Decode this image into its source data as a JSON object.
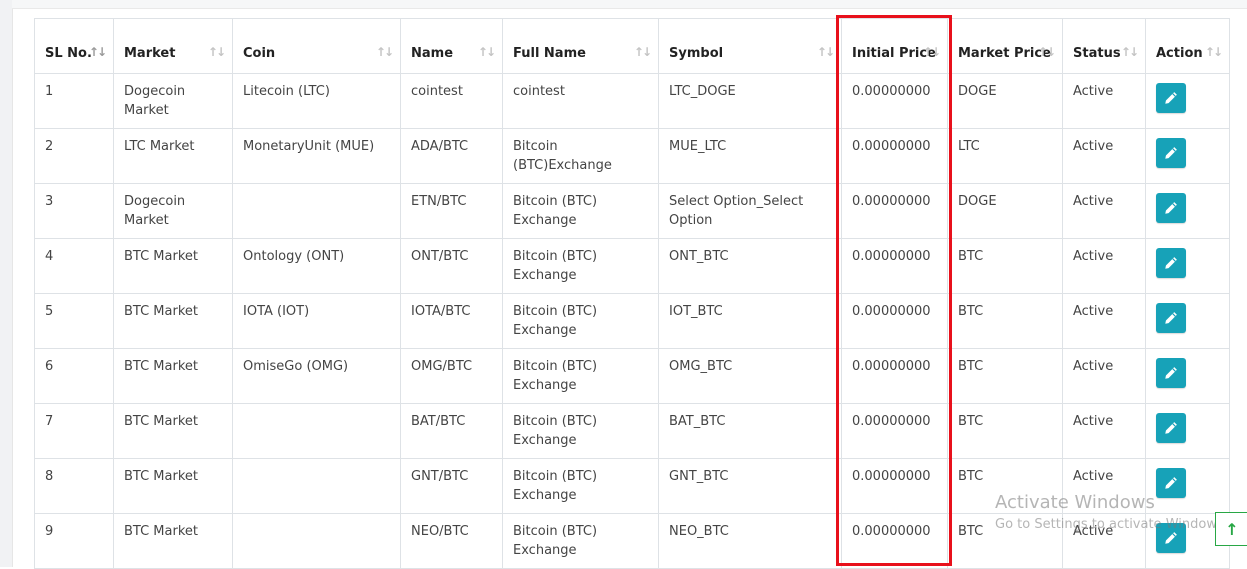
{
  "table": {
    "headers": [
      {
        "label": "SL No.",
        "key": "sl"
      },
      {
        "label": "Market",
        "key": "market"
      },
      {
        "label": "Coin",
        "key": "coin"
      },
      {
        "label": "Name",
        "key": "name"
      },
      {
        "label": "Full Name",
        "key": "fullname"
      },
      {
        "label": "Symbol",
        "key": "symbol"
      },
      {
        "label": "Initial Price",
        "key": "initial"
      },
      {
        "label": "Market Price",
        "key": "marketprice"
      },
      {
        "label": "Status",
        "key": "status"
      },
      {
        "label": "Action",
        "key": "action"
      }
    ],
    "sort_glyph": "↑↓",
    "rows": [
      {
        "sl": "1",
        "market": "Dogecoin Market",
        "coin": "Litecoin (LTC)",
        "name": "cointest",
        "fullname": "cointest",
        "symbol": "LTC_DOGE",
        "initial": "0.00000000",
        "marketprice": "DOGE",
        "status": "Active"
      },
      {
        "sl": "2",
        "market": "LTC Market",
        "coin": "MonetaryUnit (MUE)",
        "name": "ADA/BTC",
        "fullname": "Bitcoin (BTC)Exchange",
        "symbol": "MUE_LTC",
        "initial": "0.00000000",
        "marketprice": "LTC",
        "status": "Active"
      },
      {
        "sl": "3",
        "market": "Dogecoin Market",
        "coin": "",
        "name": "ETN/BTC",
        "fullname": "Bitcoin (BTC) Exchange",
        "symbol": "Select Option_Select Option",
        "initial": "0.00000000",
        "marketprice": "DOGE",
        "status": "Active"
      },
      {
        "sl": "4",
        "market": "BTC Market",
        "coin": "Ontology (ONT)",
        "name": "ONT/BTC",
        "fullname": "Bitcoin (BTC) Exchange",
        "symbol": "ONT_BTC",
        "initial": "0.00000000",
        "marketprice": "BTC",
        "status": "Active"
      },
      {
        "sl": "5",
        "market": "BTC Market",
        "coin": "IOTA (IOT)",
        "name": "IOTA/BTC",
        "fullname": "Bitcoin (BTC) Exchange",
        "symbol": "IOT_BTC",
        "initial": "0.00000000",
        "marketprice": "BTC",
        "status": "Active"
      },
      {
        "sl": "6",
        "market": "BTC Market",
        "coin": "OmiseGo (OMG)",
        "name": "OMG/BTC",
        "fullname": "Bitcoin (BTC) Exchange",
        "symbol": "OMG_BTC",
        "initial": "0.00000000",
        "marketprice": "BTC",
        "status": "Active"
      },
      {
        "sl": "7",
        "market": "BTC Market",
        "coin": "",
        "name": "BAT/BTC",
        "fullname": "Bitcoin (BTC) Exchange",
        "symbol": "BAT_BTC",
        "initial": "0.00000000",
        "marketprice": "BTC",
        "status": "Active"
      },
      {
        "sl": "8",
        "market": "BTC Market",
        "coin": "",
        "name": "GNT/BTC",
        "fullname": "Bitcoin (BTC) Exchange",
        "symbol": "GNT_BTC",
        "initial": "0.00000000",
        "marketprice": "BTC",
        "status": "Active"
      },
      {
        "sl": "9",
        "market": "BTC Market",
        "coin": "",
        "name": "NEO/BTC",
        "fullname": "Bitcoin (BTC) Exchange",
        "symbol": "NEO_BTC",
        "initial": "0.00000000",
        "marketprice": "BTC",
        "status": "Active"
      }
    ],
    "action_icon": "pencil-edit-icon"
  },
  "watermark": {
    "title": "Activate Windows",
    "subtitle": "Go to Settings to activate Windows."
  },
  "scroll_top": {
    "icon": "arrow-up-icon",
    "glyph": "↑"
  },
  "colors": {
    "highlight": "#e8101b",
    "edit_button": "#17a2b8",
    "scroll_top": "#28a745",
    "grid": "#dee2e6"
  }
}
